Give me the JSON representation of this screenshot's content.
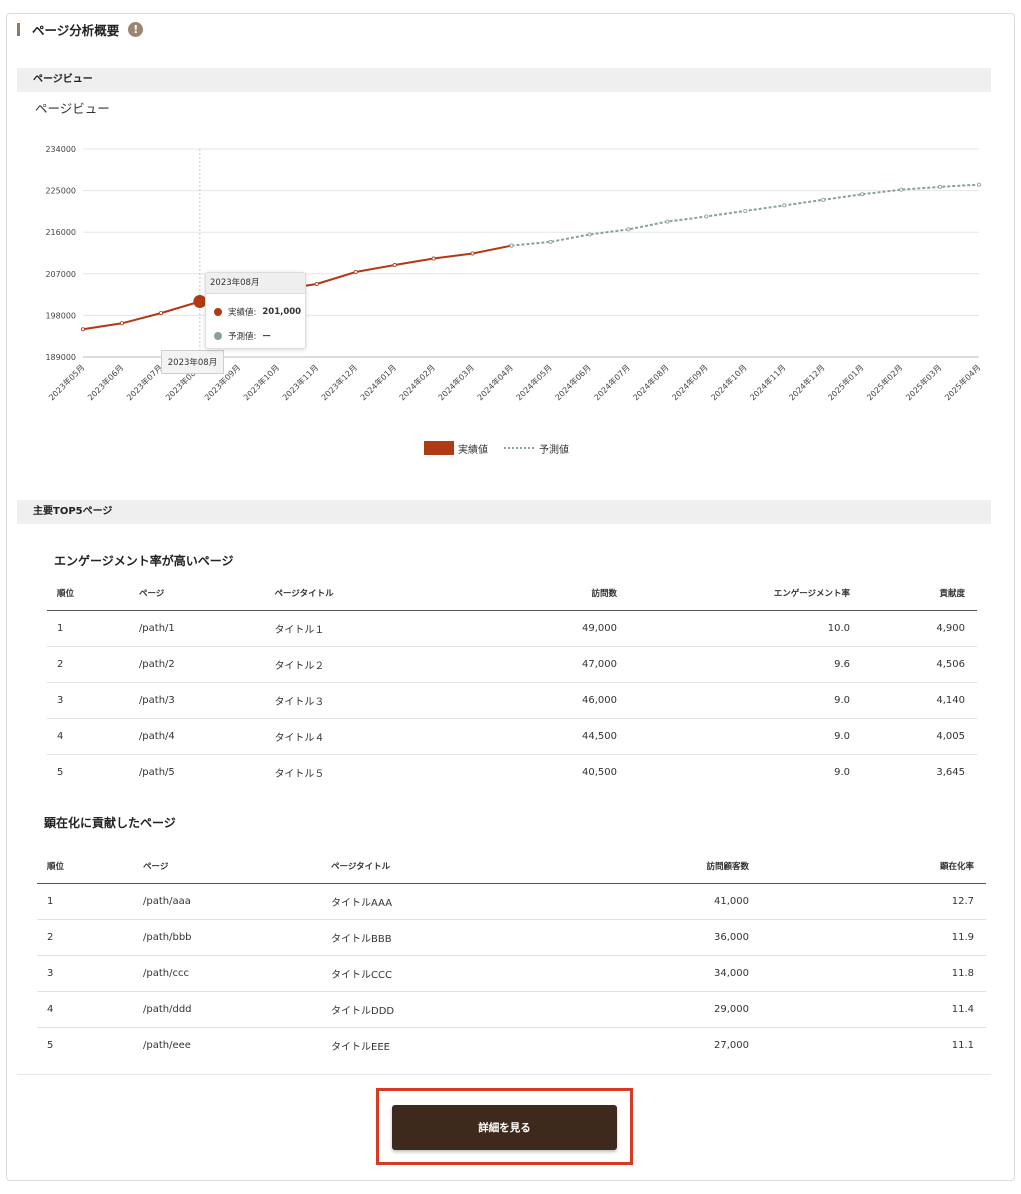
{
  "page": {
    "title": "ページ分析概要",
    "info_icon": "!"
  },
  "section_pageview": {
    "label": "ページビュー",
    "chart_title": "ページビュー",
    "tooltip": {
      "date": "2023年08月",
      "actual_label": "実績値:",
      "actual_value": "201,000",
      "forecast_label": "予測値:",
      "forecast_value": "ー"
    },
    "crosshair_label": "2023年08月",
    "legend": {
      "actual": "実績値",
      "forecast": "予測値"
    }
  },
  "chart_data": {
    "type": "line",
    "title": "ページビュー",
    "categories": [
      "2023年05月",
      "2023年06月",
      "2023年07月",
      "2023年08月",
      "2023年09月",
      "2023年10月",
      "2023年11月",
      "2023年12月",
      "2024年01月",
      "2024年02月",
      "2024年03月",
      "2024年04月",
      "2024年05月",
      "2024年06月",
      "2024年07月",
      "2024年08月",
      "2024年09月",
      "2024年10月",
      "2024年11月",
      "2024年12月",
      "2025年01月",
      "2025年02月",
      "2025年03月",
      "2025年04月"
    ],
    "y_ticks": [
      "189000",
      "198000",
      "207000",
      "216000",
      "225000",
      "234000"
    ],
    "ylim": [
      189000,
      234000
    ],
    "series": [
      {
        "name": "実績値",
        "color": "#b03a14",
        "style": "solid",
        "values": [
          195000,
          196300,
          198500,
          201000,
          202800,
          203500,
          204800,
          207400,
          208900,
          210300,
          211400,
          213100,
          null,
          null,
          null,
          null,
          null,
          null,
          null,
          null,
          null,
          null,
          null,
          null
        ]
      },
      {
        "name": "予測値",
        "color": "#8aa09a",
        "style": "dotted",
        "values": [
          null,
          null,
          null,
          null,
          null,
          null,
          null,
          null,
          null,
          null,
          null,
          213100,
          213900,
          215500,
          216600,
          218300,
          219400,
          220600,
          221800,
          223000,
          224200,
          225200,
          225800,
          226300
        ]
      }
    ],
    "highlight_index": 3,
    "grid": true,
    "legend_position": "bottom"
  },
  "section_top5": {
    "label": "主要TOP5ページ"
  },
  "engagement_table": {
    "heading": "エンゲージメント率が高いページ",
    "columns": [
      "順位",
      "ページ",
      "ページタイトル",
      "訪問数",
      "エンゲージメント率",
      "貢献度"
    ],
    "rows": [
      [
        "1",
        "/path/1",
        "タイトル１",
        "49,000",
        "10.0",
        "4,900"
      ],
      [
        "2",
        "/path/2",
        "タイトル２",
        "47,000",
        "9.6",
        "4,506"
      ],
      [
        "3",
        "/path/3",
        "タイトル３",
        "46,000",
        "9.0",
        "4,140"
      ],
      [
        "4",
        "/path/4",
        "タイトル４",
        "44,500",
        "9.0",
        "4,005"
      ],
      [
        "5",
        "/path/5",
        "タイトル５",
        "40,500",
        "9.0",
        "3,645"
      ]
    ]
  },
  "visibility_table": {
    "heading": "顕在化に貢献したページ",
    "columns": [
      "順位",
      "ページ",
      "ページタイトル",
      "訪問顧客数",
      "顕在化率"
    ],
    "rows": [
      [
        "1",
        "/path/aaa",
        "タイトルAAA",
        "41,000",
        "12.7"
      ],
      [
        "2",
        "/path/bbb",
        "タイトルBBB",
        "36,000",
        "11.9"
      ],
      [
        "3",
        "/path/ccc",
        "タイトルCCC",
        "34,000",
        "11.8"
      ],
      [
        "4",
        "/path/ddd",
        "タイトルDDD",
        "29,000",
        "11.4"
      ],
      [
        "5",
        "/path/eee",
        "タイトルEEE",
        "27,000",
        "11.1"
      ]
    ]
  },
  "footer": {
    "detail_button": "詳細を見る"
  }
}
